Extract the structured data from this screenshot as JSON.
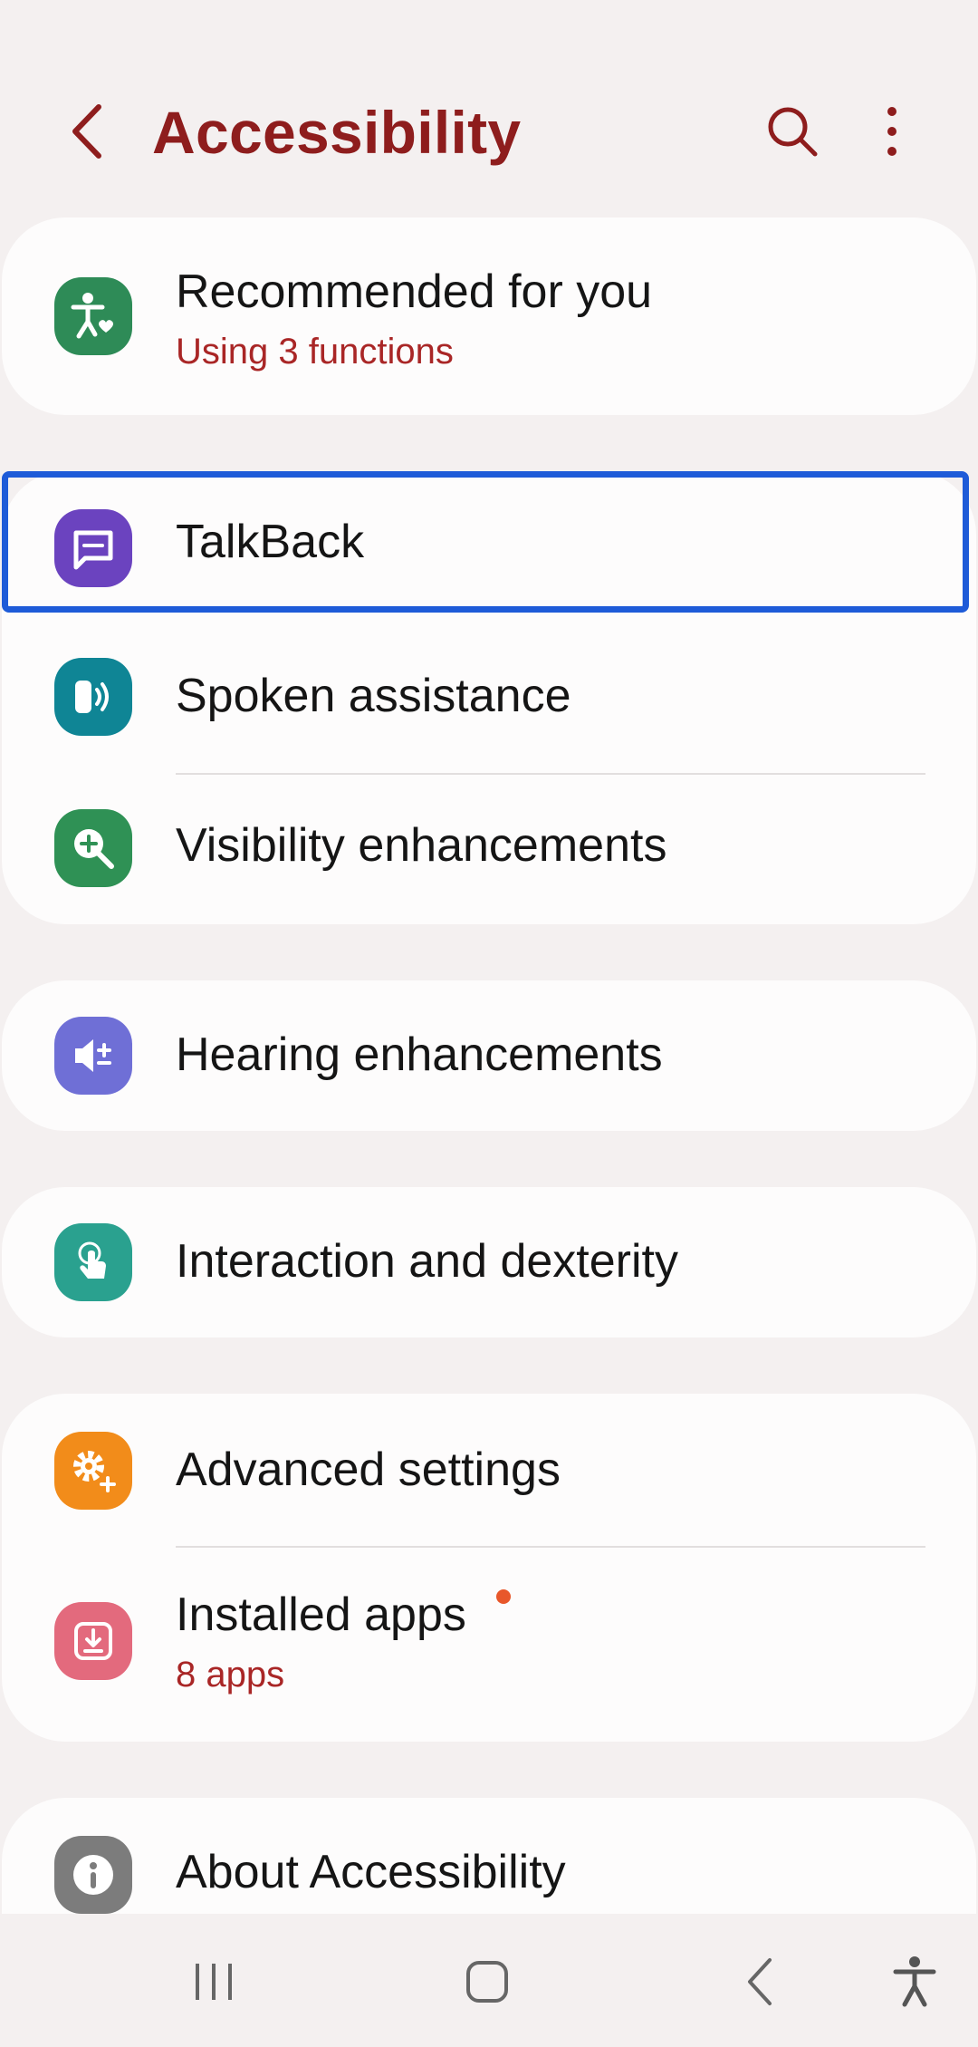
{
  "header": {
    "title": "Accessibility",
    "back_icon": "chevron-left-icon",
    "search_icon": "search-icon",
    "more_icon": "more-vertical-icon",
    "accent_color": "#8e1d1d"
  },
  "sections": [
    {
      "items": [
        {
          "label": "Recommended for you",
          "subtitle": "Using 3 functions",
          "icon": "accessibility-heart-icon",
          "icon_color": "#2e8b57"
        }
      ]
    },
    {
      "items": [
        {
          "label": "TalkBack",
          "icon": "chat-bubble-icon",
          "icon_color": "#6b43bf",
          "focused": true
        },
        {
          "label": "Spoken assistance",
          "icon": "speaker-sound-icon",
          "icon_color": "#0f8595"
        },
        {
          "label": "Visibility enhancements",
          "icon": "magnifier-plus-icon",
          "icon_color": "#2f9155"
        }
      ]
    },
    {
      "items": [
        {
          "label": "Hearing enhancements",
          "icon": "volume-plus-icon",
          "icon_color": "#6f6fd6"
        }
      ]
    },
    {
      "items": [
        {
          "label": "Interaction and dexterity",
          "icon": "touch-hand-icon",
          "icon_color": "#2aa18f"
        }
      ]
    },
    {
      "items": [
        {
          "label": "Advanced settings",
          "icon": "gear-plus-icon",
          "icon_color": "#f28c1a"
        },
        {
          "label": "Installed apps",
          "subtitle": "8 apps",
          "icon": "download-tray-icon",
          "icon_color": "#e36a7d",
          "badge_color": "#e8572a"
        }
      ]
    },
    {
      "items": [
        {
          "label": "About Accessibility",
          "icon": "info-icon",
          "icon_color": "#7c7c7c"
        }
      ]
    }
  ],
  "navbar": {
    "recents_icon": "recents-icon",
    "home_icon": "home-icon",
    "back_icon": "back-icon",
    "accessibility_icon": "accessibility-person-icon"
  }
}
